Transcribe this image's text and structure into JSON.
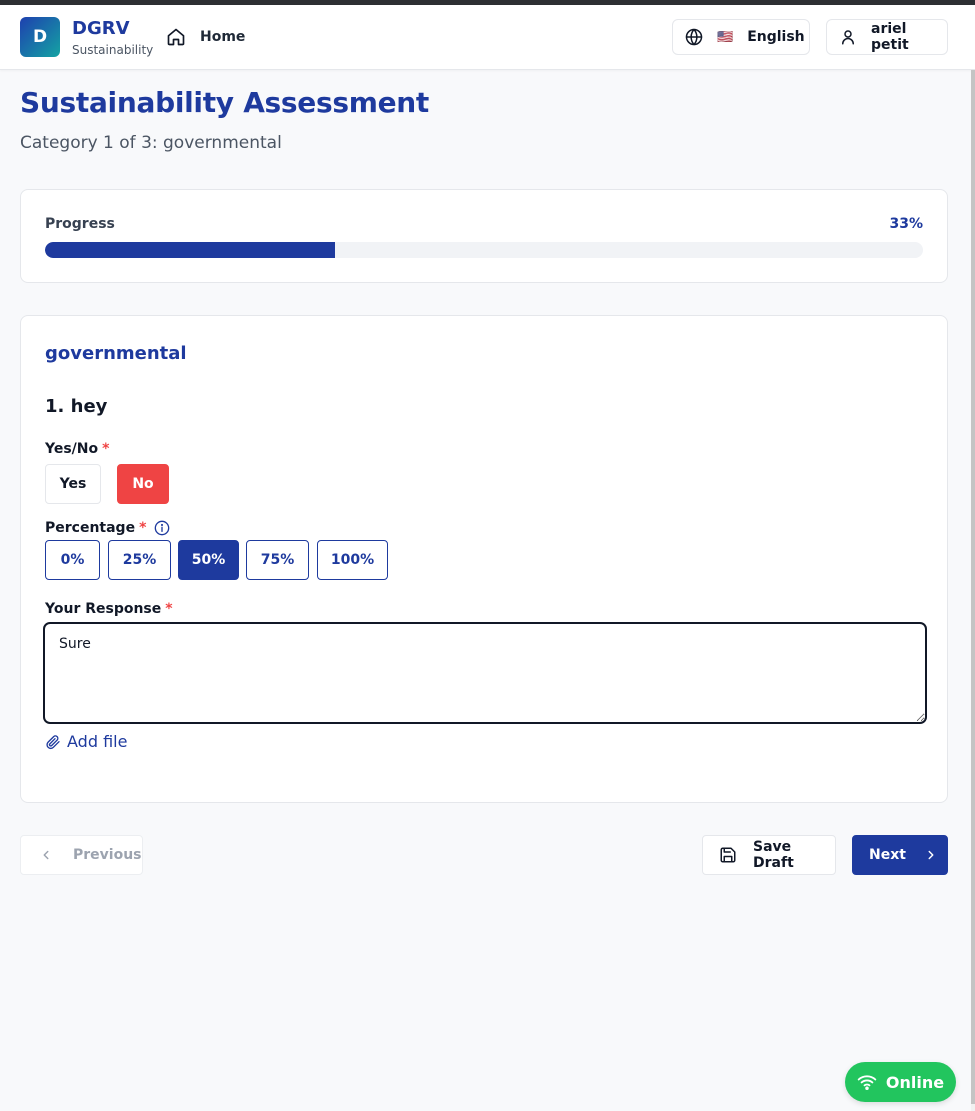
{
  "header": {
    "logo_letter": "D",
    "brand_name": "DGRV",
    "brand_subtitle": "Sustainability",
    "home_label": "Home",
    "language_flag": "🇺🇸",
    "language_label": "English",
    "user_name": "ariel petit"
  },
  "page": {
    "title": "Sustainability Assessment",
    "subtitle": "Category 1 of 3: governmental"
  },
  "progress": {
    "label": "Progress",
    "value_text": "33%",
    "fraction": 0.33
  },
  "question": {
    "category": "governmental",
    "title": "1. hey",
    "yes_no": {
      "label": "Yes/No",
      "required_mark": "*",
      "yes_label": "Yes",
      "no_label": "No",
      "selected": "No"
    },
    "percentage": {
      "label": "Percentage",
      "required_mark": "*",
      "options": [
        "0%",
        "25%",
        "50%",
        "75%",
        "100%"
      ],
      "selected": "50%"
    },
    "response": {
      "label": "Your Response",
      "required_mark": "*",
      "value": "Sure"
    },
    "add_file_label": "Add file"
  },
  "navigation": {
    "previous_label": "Previous",
    "save_draft_label": "Save Draft",
    "next_label": "Next"
  },
  "status": {
    "label": "Online"
  },
  "colors": {
    "primary": "#1e3a9e",
    "danger": "#ef4444",
    "success": "#22c55e"
  }
}
